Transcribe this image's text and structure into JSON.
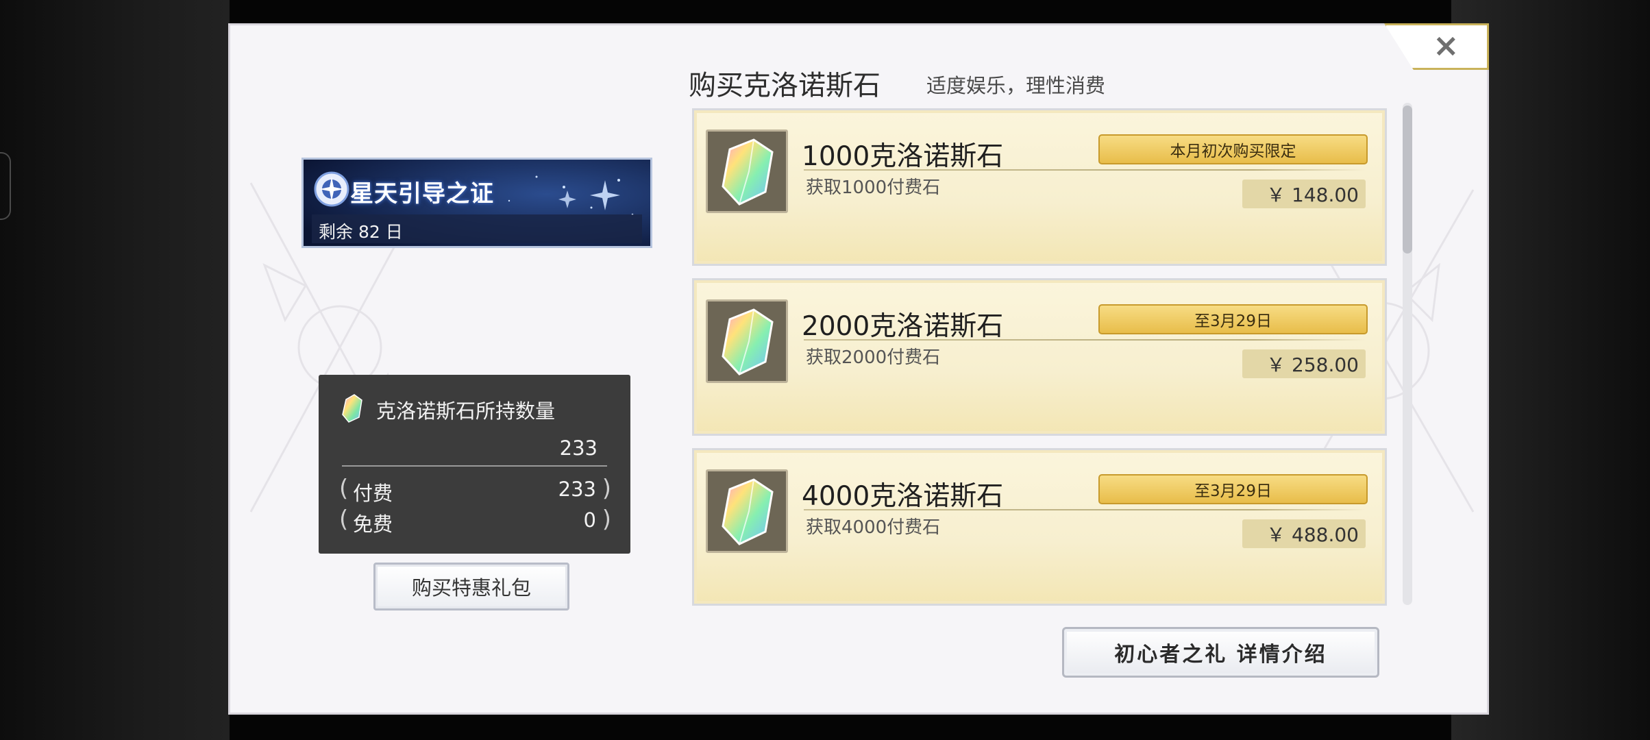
{
  "dialog": {
    "close_label": "×"
  },
  "banner": {
    "title": "星天引导之证",
    "days_left": "剩余 82 日"
  },
  "holdings": {
    "title": "克洛诺斯石所持数量",
    "total": "233",
    "paid_label": "付费",
    "paid_value": "233",
    "free_label": "免费",
    "free_value": "0"
  },
  "gift_button": "购买特惠礼包",
  "header": {
    "title": "购买克洛诺斯石",
    "subtitle": "适度娱乐，理性消费"
  },
  "products": [
    {
      "name": "1000克洛诺斯石",
      "desc": "获取1000付费石",
      "badge": "本月初次购买限定",
      "price": "￥ 148.00"
    },
    {
      "name": "2000克洛诺斯石",
      "desc": "获取2000付费石",
      "badge": "至3月29日",
      "price": "￥ 258.00"
    },
    {
      "name": "4000克洛诺斯石",
      "desc": "获取4000付费石",
      "badge": "至3月29日",
      "price": "￥ 488.00"
    }
  ],
  "detail_button": "初心者之礼 详情介绍",
  "colors": {
    "badge_gold": "#e8bd4a",
    "card_cream": "#f7efcf",
    "panel_dark": "#3c3c3c",
    "dialog_bg": "#f6f5f8"
  },
  "icons": [
    "crystal-icon",
    "close-icon",
    "banner-emblem-icon"
  ]
}
